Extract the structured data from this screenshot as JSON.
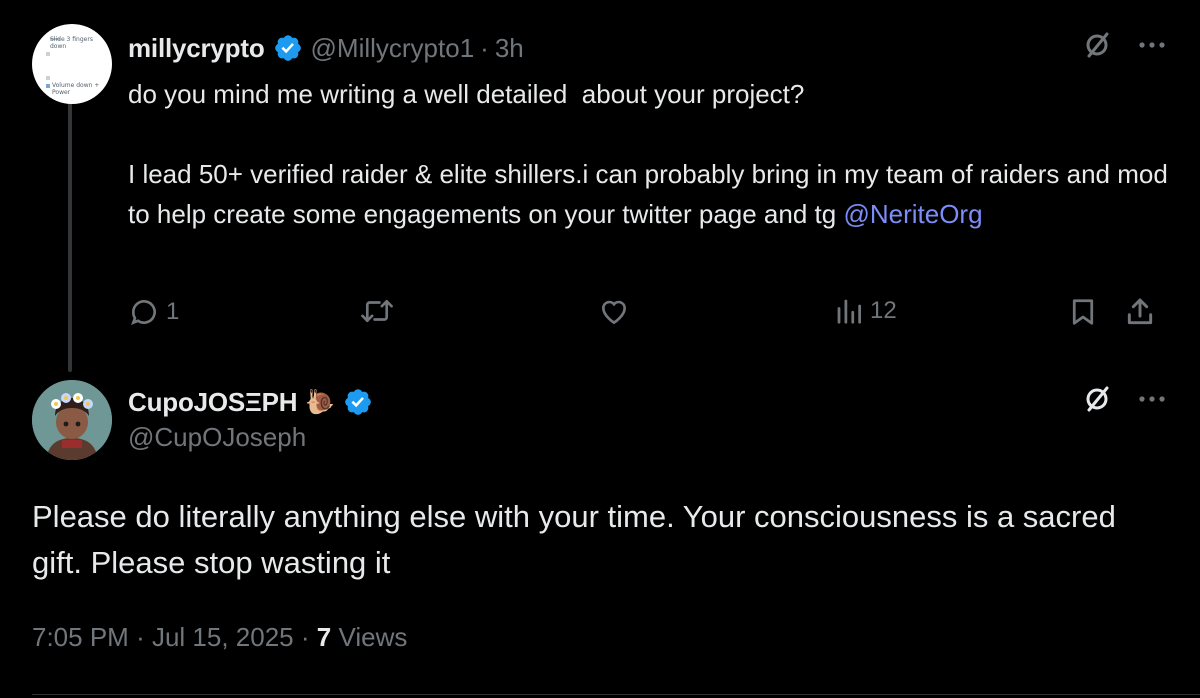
{
  "reply": {
    "display_name": "millycrypto",
    "handle": "@Millycrypto1",
    "separator": "·",
    "time": "3h",
    "avatar_text": [
      "Slide 3 fingers",
      "down",
      "Volume down +",
      "Power"
    ],
    "text_line1": "do you mind me writing a well detailed  about your project?",
    "text_line2": "I lead 50+ verified raider & elite shillers.i can probably bring in my team of raiders and mod  to help create some engagements on your twitter page and tg ",
    "mention": "@NeriteOrg",
    "actions": {
      "reply_count": "1",
      "retweet_count": "",
      "like_count": "",
      "views_count": "12"
    }
  },
  "main": {
    "display_name": "CupoJOSΞPH",
    "snail_emoji": "🐌",
    "handle": "@CupOJoseph",
    "text": "Please do literally anything else with your time. Your consciousness is a sacred gift. Please stop wasting it",
    "timestamp": "7:05 PM",
    "date": "Jul 15, 2025",
    "separator": "·",
    "views_count": "7",
    "views_label": "Views"
  },
  "colors": {
    "background": "#000000",
    "text": "#e7e9ea",
    "muted": "#71767b",
    "mention": "#7c8cf8",
    "verified": "#1d9bf0"
  },
  "icons": [
    "grok-icon",
    "more-icon",
    "reply-icon",
    "retweet-icon",
    "like-icon",
    "views-icon",
    "bookmark-icon",
    "share-icon",
    "verified-icon"
  ]
}
